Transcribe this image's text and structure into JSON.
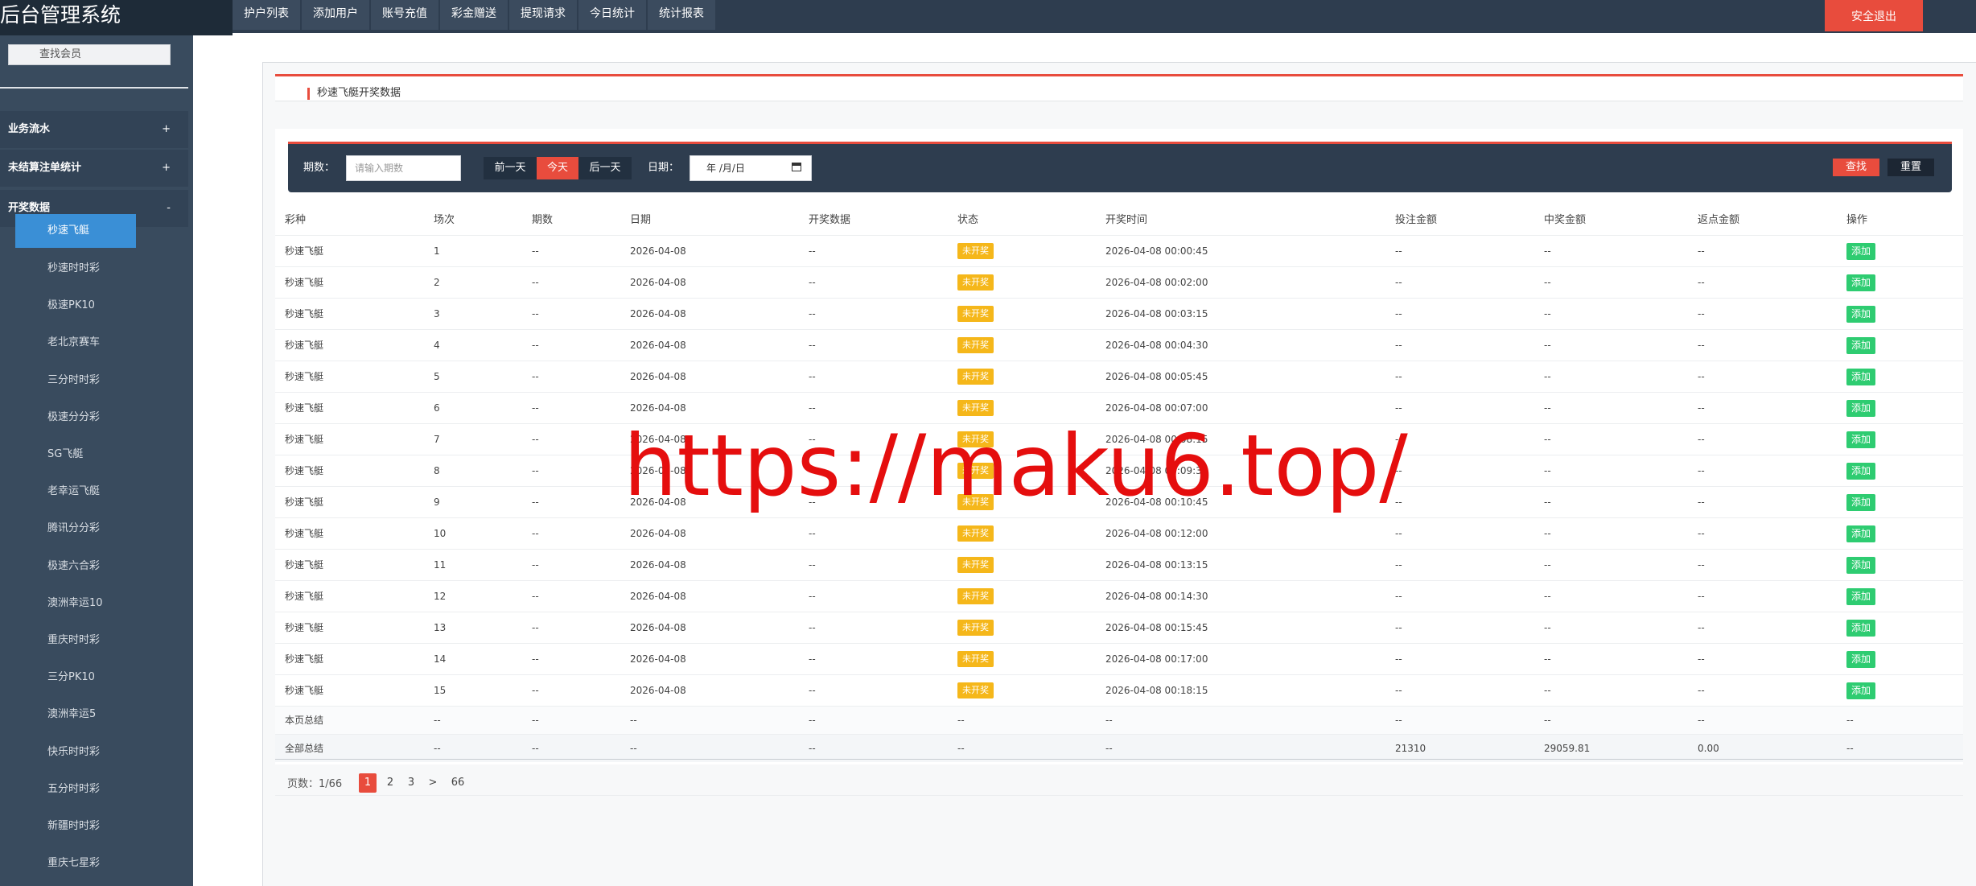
{
  "app": {
    "title": "后台管理系统"
  },
  "top_nav": [
    {
      "label": "护户列表"
    },
    {
      "label": "添加用户"
    },
    {
      "label": "账号充值"
    },
    {
      "label": "彩金赠送"
    },
    {
      "label": "提现请求"
    },
    {
      "label": "今日统计"
    },
    {
      "label": "统计报表"
    }
  ],
  "logout_label": "安全退出",
  "sidebar": {
    "search_label": "查找会员",
    "groups": [
      {
        "label": "业务流水",
        "sign": "+"
      },
      {
        "label": "未结算注单统计",
        "sign": "+"
      },
      {
        "label": "开奖数据",
        "sign": "-"
      }
    ],
    "active_item": "秒速飞艇",
    "items": [
      "秒速时时彩",
      "极速PK10",
      "老北京赛车",
      "三分时时彩",
      "极速分分彩",
      "SG飞艇",
      "老幸运飞艇",
      "腾讯分分彩",
      "极速六合彩",
      "澳洲幸运10",
      "重庆时时彩",
      "三分PK10",
      "澳洲幸运5",
      "快乐时时彩",
      "五分时时彩",
      "新疆时时彩",
      "重庆七星彩"
    ]
  },
  "panel": {
    "title": "秒速飞艇开奖数据"
  },
  "filter": {
    "issue_label": "期数：",
    "issue_placeholder": "请输入期数",
    "prev_day": "前一天",
    "today": "今天",
    "next_day": "后一天",
    "date_label": "日期：",
    "date_value": "年 /月/日",
    "search_button": "查找",
    "reset_button": "重置"
  },
  "table": {
    "columns": [
      "彩种",
      "场次",
      "期数",
      "日期",
      "开奖数据",
      "状态",
      "开奖时间",
      "投注金额",
      "中奖金额",
      "返点金额",
      "操作"
    ],
    "rows": [
      {
        "game": "秒速飞艇",
        "round": "1",
        "issue": "--",
        "date": "2026-04-08",
        "result": "--",
        "status": "未开奖",
        "time": "2026-04-08 00:00:45",
        "bet": "--",
        "win": "--",
        "rebate": "--",
        "action": "添加"
      },
      {
        "game": "秒速飞艇",
        "round": "2",
        "issue": "--",
        "date": "2026-04-08",
        "result": "--",
        "status": "未开奖",
        "time": "2026-04-08 00:02:00",
        "bet": "--",
        "win": "--",
        "rebate": "--",
        "action": "添加"
      },
      {
        "game": "秒速飞艇",
        "round": "3",
        "issue": "--",
        "date": "2026-04-08",
        "result": "--",
        "status": "未开奖",
        "time": "2026-04-08 00:03:15",
        "bet": "--",
        "win": "--",
        "rebate": "--",
        "action": "添加"
      },
      {
        "game": "秒速飞艇",
        "round": "4",
        "issue": "--",
        "date": "2026-04-08",
        "result": "--",
        "status": "未开奖",
        "time": "2026-04-08 00:04:30",
        "bet": "--",
        "win": "--",
        "rebate": "--",
        "action": "添加"
      },
      {
        "game": "秒速飞艇",
        "round": "5",
        "issue": "--",
        "date": "2026-04-08",
        "result": "--",
        "status": "未开奖",
        "time": "2026-04-08 00:05:45",
        "bet": "--",
        "win": "--",
        "rebate": "--",
        "action": "添加"
      },
      {
        "game": "秒速飞艇",
        "round": "6",
        "issue": "--",
        "date": "2026-04-08",
        "result": "--",
        "status": "未开奖",
        "time": "2026-04-08 00:07:00",
        "bet": "--",
        "win": "--",
        "rebate": "--",
        "action": "添加"
      },
      {
        "game": "秒速飞艇",
        "round": "7",
        "issue": "--",
        "date": "2026-04-08",
        "result": "--",
        "status": "未开奖",
        "time": "2026-04-08 00:08:15",
        "bet": "--",
        "win": "--",
        "rebate": "--",
        "action": "添加"
      },
      {
        "game": "秒速飞艇",
        "round": "8",
        "issue": "--",
        "date": "2026-04-08",
        "result": "--",
        "status": "未开奖",
        "time": "2026-04-08 00:09:30",
        "bet": "--",
        "win": "--",
        "rebate": "--",
        "action": "添加"
      },
      {
        "game": "秒速飞艇",
        "round": "9",
        "issue": "--",
        "date": "2026-04-08",
        "result": "--",
        "status": "未开奖",
        "time": "2026-04-08 00:10:45",
        "bet": "--",
        "win": "--",
        "rebate": "--",
        "action": "添加"
      },
      {
        "game": "秒速飞艇",
        "round": "10",
        "issue": "--",
        "date": "2026-04-08",
        "result": "--",
        "status": "未开奖",
        "time": "2026-04-08 00:12:00",
        "bet": "--",
        "win": "--",
        "rebate": "--",
        "action": "添加"
      },
      {
        "game": "秒速飞艇",
        "round": "11",
        "issue": "--",
        "date": "2026-04-08",
        "result": "--",
        "status": "未开奖",
        "time": "2026-04-08 00:13:15",
        "bet": "--",
        "win": "--",
        "rebate": "--",
        "action": "添加"
      },
      {
        "game": "秒速飞艇",
        "round": "12",
        "issue": "--",
        "date": "2026-04-08",
        "result": "--",
        "status": "未开奖",
        "time": "2026-04-08 00:14:30",
        "bet": "--",
        "win": "--",
        "rebate": "--",
        "action": "添加"
      },
      {
        "game": "秒速飞艇",
        "round": "13",
        "issue": "--",
        "date": "2026-04-08",
        "result": "--",
        "status": "未开奖",
        "time": "2026-04-08 00:15:45",
        "bet": "--",
        "win": "--",
        "rebate": "--",
        "action": "添加"
      },
      {
        "game": "秒速飞艇",
        "round": "14",
        "issue": "--",
        "date": "2026-04-08",
        "result": "--",
        "status": "未开奖",
        "time": "2026-04-08 00:17:00",
        "bet": "--",
        "win": "--",
        "rebate": "--",
        "action": "添加"
      },
      {
        "game": "秒速飞艇",
        "round": "15",
        "issue": "--",
        "date": "2026-04-08",
        "result": "--",
        "status": "未开奖",
        "time": "2026-04-08 00:18:15",
        "bet": "--",
        "win": "--",
        "rebate": "--",
        "action": "添加"
      }
    ],
    "summaries": [
      {
        "label": "本页总结",
        "round": "--",
        "issue": "--",
        "date": "--",
        "result": "--",
        "status": "--",
        "time": "--",
        "bet": "--",
        "win": "--",
        "rebate": "--",
        "action": "--"
      },
      {
        "label": "全部总结",
        "round": "--",
        "issue": "--",
        "date": "--",
        "result": "--",
        "status": "--",
        "time": "--",
        "bet": "21310",
        "win": "29059.81",
        "rebate": "0.00",
        "action": "--"
      }
    ]
  },
  "pagination": {
    "label": "页数：1/66",
    "pages": [
      "1",
      "2",
      "3",
      ">",
      "66"
    ],
    "current": "1"
  },
  "watermark": "https://maku6.top/",
  "colors": {
    "header_bg": "#2e3d4f",
    "sidebar_bg": "#394b5e",
    "accent_red": "#e84c3d",
    "active_blue": "#3a8fd6",
    "badge_yellow": "#f5b71a",
    "add_green": "#2ecc71"
  }
}
